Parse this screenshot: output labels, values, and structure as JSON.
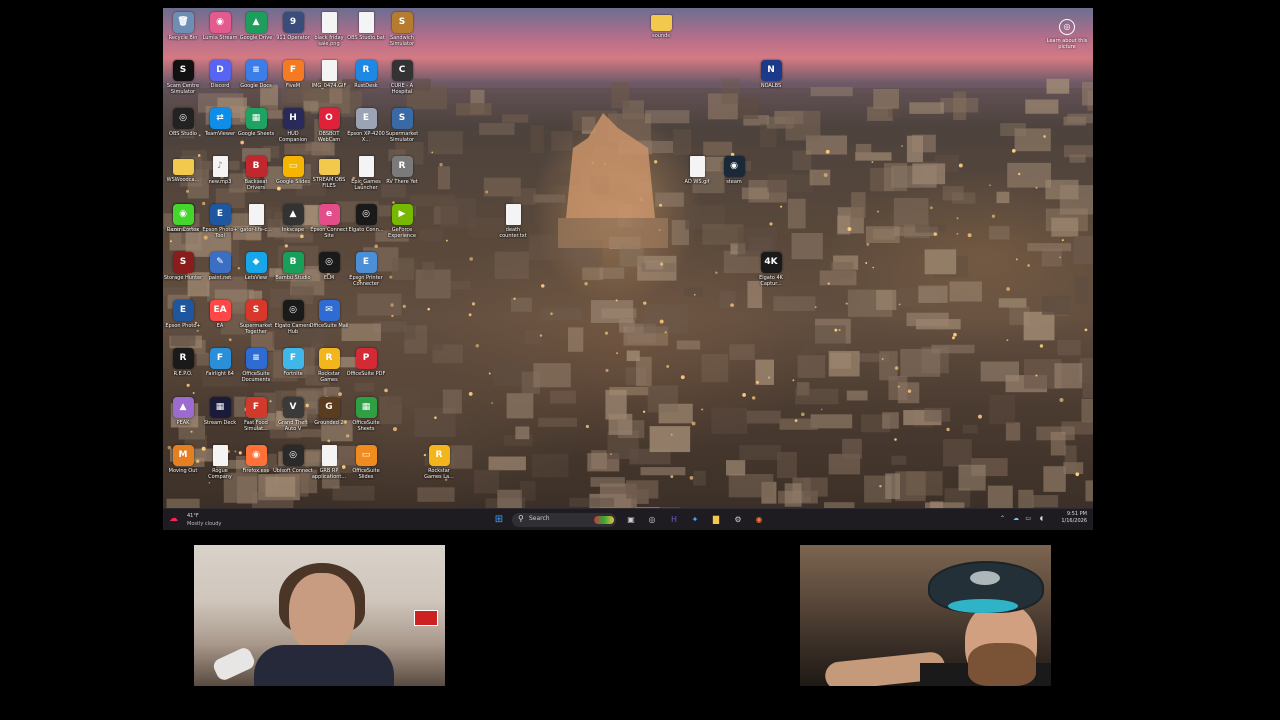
{
  "desktop": {
    "icons": [
      {
        "label": "Recycle Bin",
        "glyph": "🗑",
        "color": "#6d8fb6"
      },
      {
        "label": "Lumia Stream",
        "glyph": "◉",
        "color": "#e35a8c"
      },
      {
        "label": "Google Drive",
        "glyph": "▲",
        "color": "#1e9e5c"
      },
      {
        "label": "911 Operator",
        "glyph": "9",
        "color": "#3a4c7a"
      },
      {
        "label": "black friday sale.png",
        "glyph": "",
        "color": "#f4f4f4"
      },
      {
        "label": "OBS Studio.bat",
        "glyph": "",
        "color": "#f4f4f4"
      },
      {
        "label": "Sandwich Simulator",
        "glyph": "S",
        "color": "#b57b2f"
      },
      {
        "label": "Scam Centre Simulator",
        "glyph": "S",
        "color": "#111111"
      },
      {
        "label": "Discord",
        "glyph": "D",
        "color": "#5865f2"
      },
      {
        "label": "Google Docs",
        "glyph": "≡",
        "color": "#3b7de9"
      },
      {
        "label": "FiveM",
        "glyph": "F",
        "color": "#f57b22"
      },
      {
        "label": "IMG_0474.GIF",
        "glyph": "",
        "color": "#f4f4f4"
      },
      {
        "label": "RustDesk",
        "glyph": "R",
        "color": "#1e88e5"
      },
      {
        "label": "CURE - A Hospital",
        "glyph": "C",
        "color": "#333333"
      },
      {
        "label": "OBS Studio",
        "glyph": "◎",
        "color": "#222222"
      },
      {
        "label": "TeamViewer",
        "glyph": "⇄",
        "color": "#0e8ee9"
      },
      {
        "label": "Google Sheets",
        "glyph": "▦",
        "color": "#1ea362"
      },
      {
        "label": "HUD Companion",
        "glyph": "H",
        "color": "#2a2a5a"
      },
      {
        "label": "OBSBOT WebCam",
        "glyph": "O",
        "color": "#e0213a"
      },
      {
        "label": "Epson XP-4200 X...",
        "glyph": "E",
        "color": "#9aa4b4"
      },
      {
        "label": "Supermarket Simulator",
        "glyph": "S",
        "color": "#3a6aa5"
      },
      {
        "label": "WSWoodca...",
        "glyph": "",
        "color": "#f2c94c"
      },
      {
        "label": "new.mp3",
        "glyph": "♪",
        "color": "#f4f4f4"
      },
      {
        "label": "Backseat Drivers",
        "glyph": "B",
        "color": "#c0282d"
      },
      {
        "label": "Google Slides",
        "glyph": "▭",
        "color": "#f4b400"
      },
      {
        "label": "STREAM OBS FILES",
        "glyph": "",
        "color": "#f2c94c"
      },
      {
        "label": "Epic Games Launcher",
        "glyph": "",
        "color": "#f4f4f4"
      },
      {
        "label": "RV There Yet",
        "glyph": "R",
        "color": "#7a7a7a"
      },
      {
        "label": "ContractVille",
        "glyph": "C",
        "color": "#2b6b6a"
      },
      {
        "label": "Epson Photo+ Tool",
        "glyph": "E",
        "color": "#1e56a0"
      },
      {
        "label": "gator-life-c...",
        "glyph": "",
        "color": "#f4f4f4"
      },
      {
        "label": "Inkscape",
        "glyph": "▲",
        "color": "#333333"
      },
      {
        "label": "Epson Connect Site",
        "glyph": "e",
        "color": "#e24d8a"
      },
      {
        "label": "Elgato Conn...",
        "glyph": "◎",
        "color": "#1a1a1a"
      },
      {
        "label": "GeForce Experience",
        "glyph": "▶",
        "color": "#76b900"
      },
      {
        "label": "Razer Cortex",
        "glyph": "◉",
        "color": "#44d62c"
      },
      {
        "label": "death counter.txt",
        "glyph": "",
        "color": "#f4f4f4"
      },
      {
        "label": "Storage Hunter",
        "glyph": "S",
        "color": "#8a1c1c"
      },
      {
        "label": "paint.net",
        "glyph": "✎",
        "color": "#3a6fc4"
      },
      {
        "label": "LetsView",
        "glyph": "◆",
        "color": "#17a6e8"
      },
      {
        "label": "Bambu Studio",
        "glyph": "B",
        "color": "#18a05a"
      },
      {
        "label": "ELM",
        "glyph": "◎",
        "color": "#1a1a1a"
      },
      {
        "label": "Epson Printer Connecter",
        "glyph": "E",
        "color": "#4a8fd8"
      },
      {
        "label": "Epson Photo+",
        "glyph": "E",
        "color": "#1e56a0"
      },
      {
        "label": "EA",
        "glyph": "EA",
        "color": "#ff4747"
      },
      {
        "label": "Supermarket Together",
        "glyph": "S",
        "color": "#d9372b"
      },
      {
        "label": "Elgato Camera Hub",
        "glyph": "◎",
        "color": "#1a1a1a"
      },
      {
        "label": "OfficeSuite Mail",
        "glyph": "✉",
        "color": "#2e6bd2"
      },
      {
        "label": "R.E.P.O.",
        "glyph": "R",
        "color": "#1a1a1a"
      },
      {
        "label": "Fairlight 64",
        "glyph": "F",
        "color": "#2a8fd8"
      },
      {
        "label": "OfficeSuite Documents",
        "glyph": "≡",
        "color": "#2e6bd2"
      },
      {
        "label": "Fortnite",
        "glyph": "F",
        "color": "#3fb7e8"
      },
      {
        "label": "Rockstar Games",
        "glyph": "R",
        "color": "#f2b51c"
      },
      {
        "label": "OfficeSuite PDF",
        "glyph": "P",
        "color": "#d32a36"
      },
      {
        "label": "PEAK",
        "glyph": "▲",
        "color": "#9b6bd2"
      },
      {
        "label": "Stream Deck",
        "glyph": "▦",
        "color": "#1a1a3a"
      },
      {
        "label": "Fast Food Simulat...",
        "glyph": "F",
        "color": "#d13a2a"
      },
      {
        "label": "Grand Theft Auto V",
        "glyph": "V",
        "color": "#3a3a3a"
      },
      {
        "label": "Grounded 2",
        "glyph": "G",
        "color": "#5a3d1e"
      },
      {
        "label": "OfficeSuite Sheets",
        "glyph": "▦",
        "color": "#2ea043"
      },
      {
        "label": "Moving Out",
        "glyph": "M",
        "color": "#e67e22"
      },
      {
        "label": "Rogue Company",
        "glyph": "",
        "color": "#f4f4f4"
      },
      {
        "label": "Firefox.exe",
        "glyph": "◉",
        "color": "#ff7139"
      },
      {
        "label": "Ubisoft Connect",
        "glyph": "◎",
        "color": "#2a2a2a"
      },
      {
        "label": "GRB RP applicationt...",
        "glyph": "",
        "color": "#f4f4f4"
      },
      {
        "label": "OfficeSuite Slides",
        "glyph": "▭",
        "color": "#f08c1f"
      },
      {
        "label": "House Flipper 2",
        "glyph": "H",
        "color": "#4a86c9"
      },
      {
        "label": "Rockstar Games La...",
        "glyph": "R",
        "color": "#f2b51c"
      },
      {
        "label": "sounds",
        "glyph": "",
        "color": "#f2c94c"
      },
      {
        "label": "NOALBS",
        "glyph": "N",
        "color": "#1d3a8a"
      },
      {
        "label": "AD WS.gif",
        "glyph": "",
        "color": "#f4f4f4"
      },
      {
        "label": "steam",
        "glyph": "◉",
        "color": "#1b2838"
      },
      {
        "label": "Elgato 4K Captur...",
        "glyph": "4K",
        "color": "#1a1a1a"
      }
    ],
    "learn_label": "Learn about this picture",
    "learn_icon": "camera-icon"
  },
  "taskbar": {
    "weather_temp": "41°F",
    "weather_desc": "Mostly cloudy",
    "search_placeholder": "Search",
    "clock_time": "9:51 PM",
    "clock_date": "1/16/2026",
    "pinned": [
      {
        "name": "start",
        "glyph": "⊞",
        "color": "#3ea0ff"
      },
      {
        "name": "task-view",
        "glyph": "▣",
        "color": "#cccccc"
      },
      {
        "name": "obs",
        "glyph": "◎",
        "color": "#cccccc"
      },
      {
        "name": "hud",
        "glyph": "H",
        "color": "#6a5acd"
      },
      {
        "name": "copilot",
        "glyph": "✦",
        "color": "#4fa3ff"
      },
      {
        "name": "file-explorer",
        "glyph": "▇",
        "color": "#f2c94c"
      },
      {
        "name": "settings",
        "glyph": "⚙",
        "color": "#cccccc"
      },
      {
        "name": "firefox",
        "glyph": "◉",
        "color": "#ff7139"
      }
    ]
  }
}
